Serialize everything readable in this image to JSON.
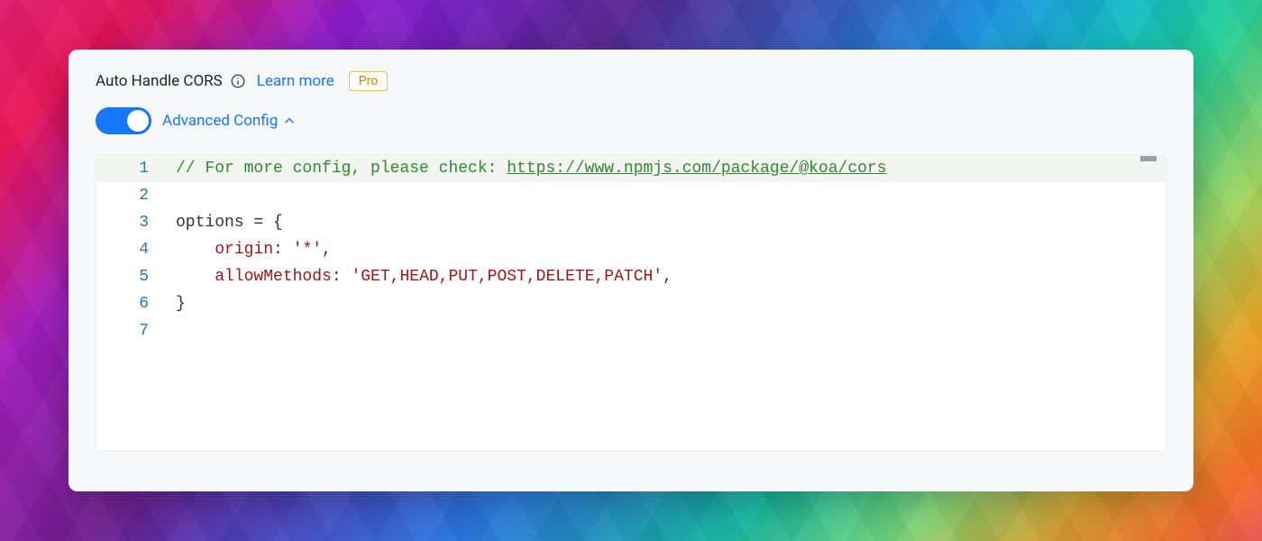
{
  "header": {
    "title": "Auto Handle CORS",
    "learn_more": "Learn more",
    "pro_badge": "Pro"
  },
  "advanced": {
    "label": "Advanced Config",
    "enabled": true,
    "expanded": true
  },
  "editor": {
    "line_numbers": [
      "1",
      "2",
      "3",
      "4",
      "5",
      "6",
      "7"
    ],
    "active_line": 1,
    "code": {
      "l1_comment_prefix": "// For more config, please check: ",
      "l1_link": "https://www.npmjs.com/package/@koa/cors",
      "l2": "",
      "l3_ident": "options",
      "l3_rest": " = {",
      "l4_indent": "    ",
      "l4_prop": "origin",
      "l4_sep": ": ",
      "l4_str": "'*'",
      "l4_tail": ",",
      "l5_indent": "    ",
      "l5_prop": "allowMethods",
      "l5_sep": ": ",
      "l5_str": "'GET,HEAD,PUT,POST,DELETE,PATCH'",
      "l5_tail": ",",
      "l6": "}",
      "l7": ""
    }
  }
}
